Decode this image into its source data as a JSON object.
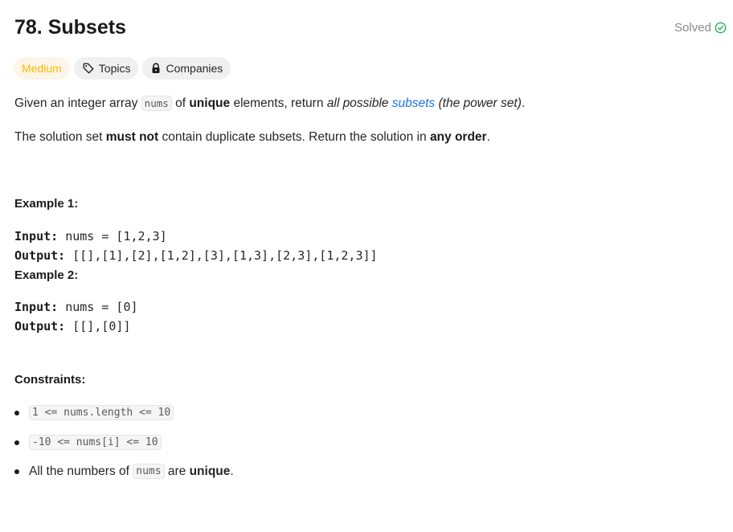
{
  "problem": {
    "title": "78. Subsets",
    "status": "Solved"
  },
  "tags": {
    "difficulty": "Medium",
    "topics": "Topics",
    "companies": "Companies"
  },
  "description": {
    "p1_a": "Given an integer array ",
    "p1_code": "nums",
    "p1_b": " of ",
    "p1_bold": "unique",
    "p1_c": " elements, return ",
    "p1_italic": "all possible",
    "p1_space": " ",
    "p1_link": "subsets",
    "p1_italic2": " (the power set)",
    "p1_end": ".",
    "p2_a": "The solution set ",
    "p2_bold1": "must not",
    "p2_b": " contain duplicate subsets. Return the solution in ",
    "p2_bold2": "any order",
    "p2_end": "."
  },
  "examples": [
    {
      "title": "Example 1:",
      "input_label": "Input:",
      "input_value": " nums = [1,2,3]",
      "output_label": "Output:",
      "output_value": " [[],[1],[2],[1,2],[3],[1,3],[2,3],[1,2,3]]"
    },
    {
      "title": "Example 2:",
      "input_label": "Input:",
      "input_value": " nums = [0]",
      "output_label": "Output:",
      "output_value": " [[],[0]]"
    }
  ],
  "constraints": {
    "title": "Constraints:",
    "c1": "1 <= nums.length <= 10",
    "c2": "-10 <= nums[i] <= 10",
    "c3_a": "All the numbers of ",
    "c3_code": "nums",
    "c3_b": " are ",
    "c3_bold": "unique",
    "c3_end": "."
  },
  "icons": {
    "solved": "check-circle-icon",
    "topics": "tag-icon",
    "companies": "lock-icon"
  },
  "colors": {
    "medium": "#ffb800",
    "solved_check": "#2db55d",
    "link": "#1a73e8"
  }
}
